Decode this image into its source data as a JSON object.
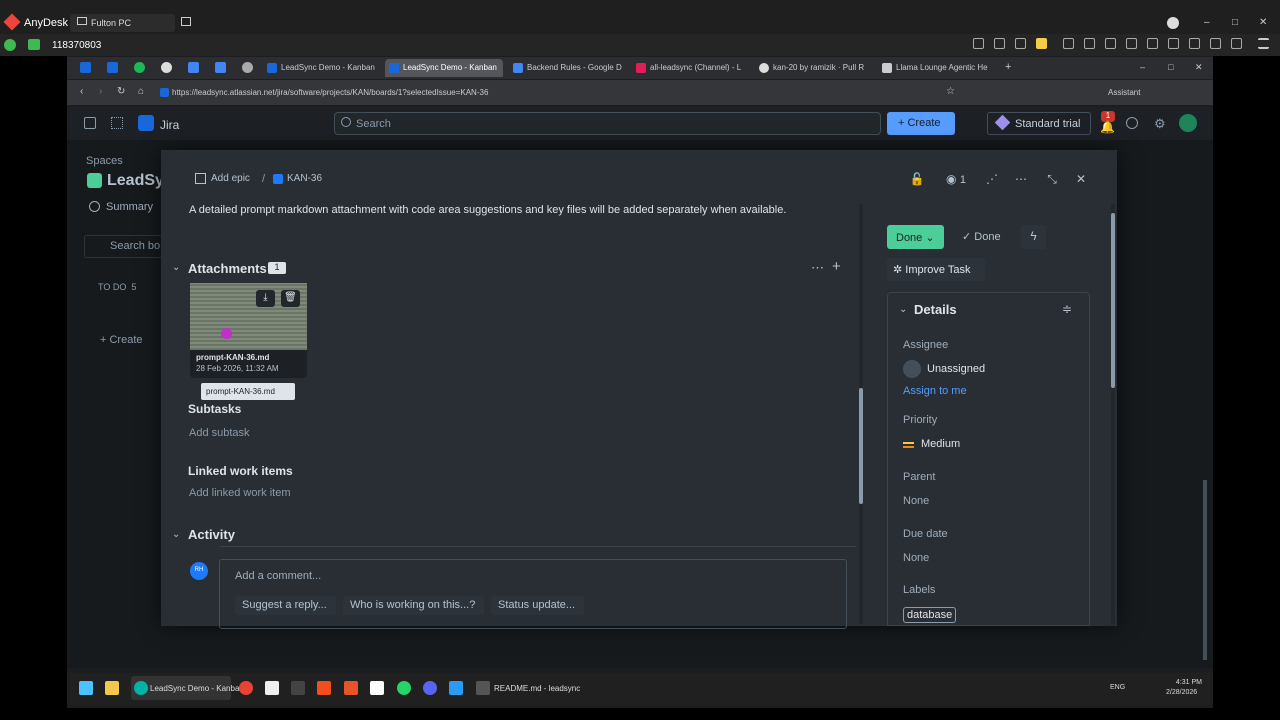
{
  "anydesk": {
    "title": "AnyDesk",
    "tab_label": "Fulton PC",
    "session_id": "118370803",
    "minimize": "–",
    "maximize": "□",
    "close": "✕"
  },
  "browser": {
    "tabs": [
      {
        "label": "LeadSync Demo - Kanban"
      },
      {
        "label": "LeadSync Demo - Kanban"
      },
      {
        "label": "Backend Rules - Google D"
      },
      {
        "label": "all-leadsync (Channel) - L"
      },
      {
        "label": "kan-20 by ramizik · Pull R"
      },
      {
        "label": "Llama Lounge Agentic He"
      }
    ],
    "url": "https://leadsync.atlassian.net/jira/software/projects/KAN/boards/1?selectedIssue=KAN-36",
    "assistant": "Assistant"
  },
  "jira": {
    "app_name": "Jira",
    "search_placeholder": "Search",
    "create_label": "Create",
    "trial_label": "Standard trial",
    "notif_count": "1",
    "avatar_initials": "RH"
  },
  "board": {
    "spaces": "Spaces",
    "project": "LeadSy",
    "summary": "Summary",
    "search": "Search bo",
    "todo": "TO DO",
    "todo_count": "5",
    "create": "Create"
  },
  "issue": {
    "add_epic": "Add epic",
    "key": "KAN-36",
    "watchers": "1",
    "description": "A detailed prompt markdown attachment with code area suggestions and key files will be added separately when available.",
    "attachments": {
      "title": "Attachments",
      "count": "1",
      "file_name": "prompt-KAN-36.md",
      "file_date": "28 Feb 2026, 11:32 AM",
      "tooltip": "prompt-KAN-36.md"
    },
    "subtasks": {
      "title": "Subtasks",
      "add": "Add subtask"
    },
    "linked": {
      "title": "Linked work items",
      "add": "Add linked work item"
    },
    "activity": {
      "title": "Activity",
      "avatar": "RH",
      "comment_placeholder": "Add a comment...",
      "suggestions": [
        "Suggest a reply...",
        "Who is working on this...?",
        "Status update..."
      ]
    },
    "status": {
      "button": "Done",
      "resolution": "Done"
    },
    "improve": "Improve Task",
    "details": {
      "title": "Details",
      "assignee_label": "Assignee",
      "assignee_value": "Unassigned",
      "assign_me": "Assign to me",
      "priority_label": "Priority",
      "priority_value": "Medium",
      "parent_label": "Parent",
      "parent_value": "None",
      "due_label": "Due date",
      "due_value": "None",
      "labels_label": "Labels",
      "label_value": "database"
    }
  },
  "taskbar": {
    "active_app": "LeadSync Demo - Kanba",
    "readme": "README.md - leadsync",
    "lang": "ENG",
    "time": "4:31 PM",
    "date": "2/28/2026"
  }
}
